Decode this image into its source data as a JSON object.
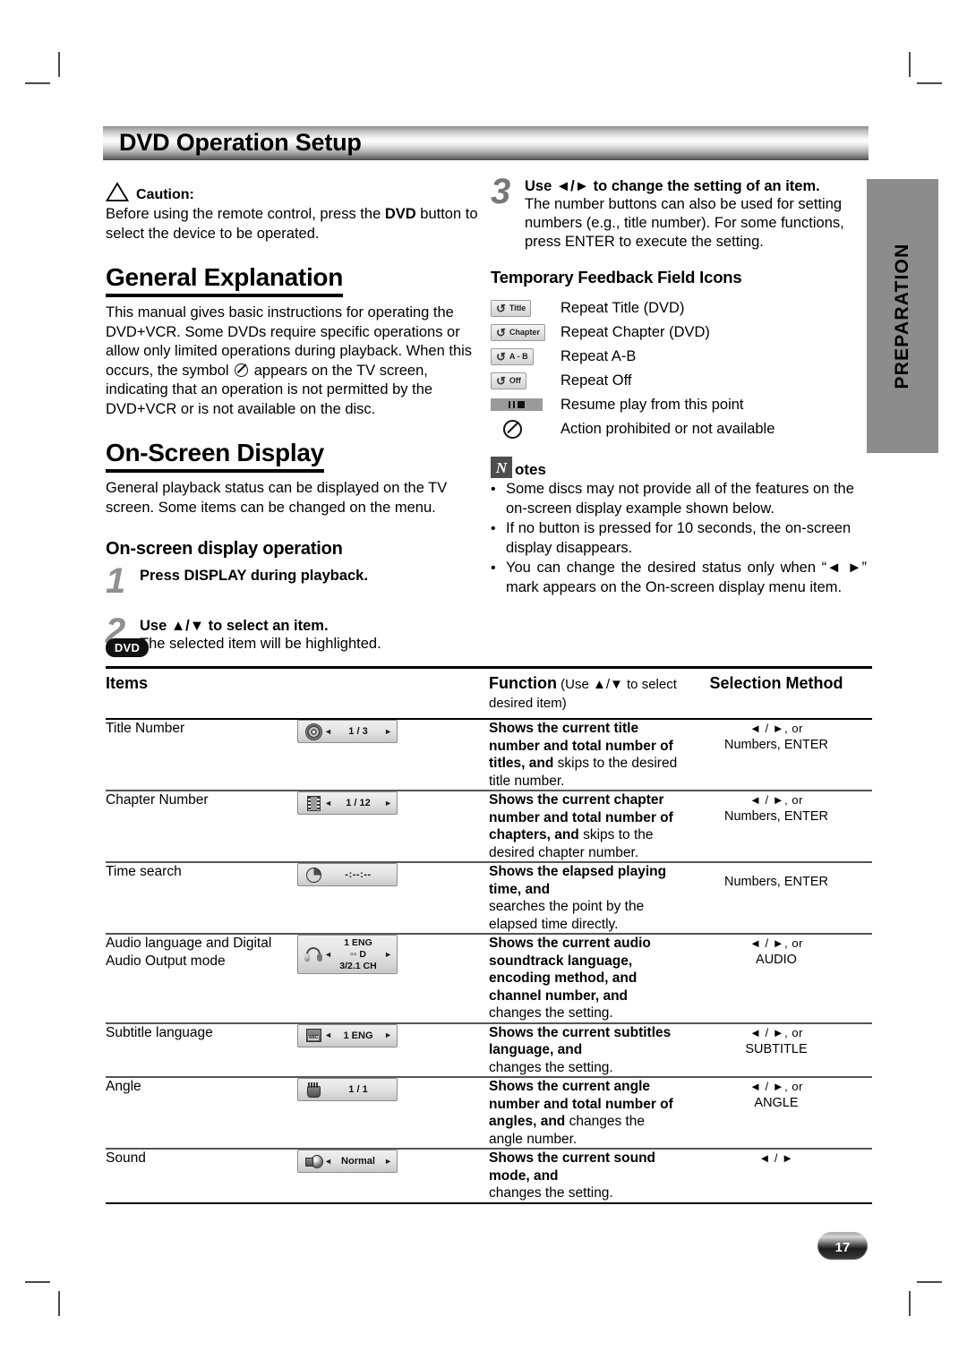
{
  "page": {
    "banner_title": "DVD Operation Setup",
    "side_tab": "PREPARATION",
    "page_number": "17",
    "disc_badge": "DVD"
  },
  "left": {
    "caution_label": "Caution:",
    "caution_text_a": "Before using the remote control, press the ",
    "caution_text_bold": "DVD",
    "caution_text_b": " button to select the device to be operated.",
    "general_heading": "General Explanation",
    "general_text_a": "This manual gives basic instructions for operating the DVD+VCR. Some DVDs require specific operations or allow only limited operations during playback. When this occurs, the symbol ",
    "general_text_b": " appears on the TV screen, indicating that an operation is not permitted by the DVD+VCR or is not available on the disc.",
    "osd_heading": "On-Screen Display",
    "osd_text": "General playback status can be displayed on the TV screen. Some items can be changed on the menu.",
    "osd_op_heading": "On-screen display operation",
    "steps": [
      {
        "num": "1",
        "title": "Press DISPLAY during playback.",
        "body": ""
      },
      {
        "num": "2",
        "title": "Use ▲/▼ to select an item.",
        "body": "The selected item will be highlighted."
      }
    ]
  },
  "right": {
    "step3": {
      "num": "3",
      "title": "Use ◄/► to change the setting of an item.",
      "body": "The number buttons can also be used for setting numbers (e.g., title number). For some functions, press ENTER to execute the setting."
    },
    "tff_heading": "Temporary Feedback Field Icons",
    "tff_items": [
      {
        "chip": "Title",
        "glyph": "↺",
        "label": "Repeat Title (DVD)",
        "kind": "chip"
      },
      {
        "chip": "Chapter",
        "glyph": "↺",
        "label": "Repeat Chapter (DVD)",
        "kind": "chip"
      },
      {
        "chip": "A - B",
        "glyph": "↺",
        "label": "Repeat A-B",
        "kind": "chip"
      },
      {
        "chip": "Off",
        "glyph": "↺",
        "label": "Repeat Off",
        "kind": "chip"
      },
      {
        "chip": "",
        "glyph": "",
        "label": "Resume play from this point",
        "kind": "resume"
      },
      {
        "chip": "",
        "glyph": "",
        "label": "Action prohibited or not available",
        "kind": "prohibit"
      }
    ],
    "notes_word": "otes",
    "notes_initial": "N",
    "notes": [
      "Some discs may not provide all of the features on the on-screen display example shown below.",
      "If no button is pressed for 10 seconds, the on-screen display disappears.",
      "You can change the desired status only when “◄ ►” mark appears on the On-screen display menu item."
    ]
  },
  "table": {
    "headers": {
      "items": "Items",
      "function_bold": "Function",
      "function_light": " (Use ▲/▼ to select desired item)",
      "selection": "Selection Method"
    },
    "rows": [
      {
        "item": "Title Number",
        "icon": "disc-icon",
        "osd": {
          "style": "single",
          "left_caret": "◄",
          "value": "1 / 3",
          "right_caret": "►"
        },
        "func_bold": "Shows the current title number and total number of titles, and",
        "func_rest": " skips to the desired title number.",
        "sel_line1": "◄ / ►, or",
        "sel_line2": "Numbers, ENTER"
      },
      {
        "item": "Chapter Number",
        "icon": "film-icon",
        "osd": {
          "style": "single",
          "left_caret": "◄",
          "value": "1 / 12",
          "right_caret": "►"
        },
        "func_bold": "Shows the current chapter number and total number of chapters, and",
        "func_rest": " skips to the desired chapter number.",
        "sel_line1": "◄ / ►, or",
        "sel_line2": "Numbers, ENTER"
      },
      {
        "item": "Time search",
        "icon": "clock-icon",
        "osd": {
          "style": "novalue",
          "left_caret": "",
          "value": "-:--:--",
          "right_caret": ""
        },
        "func_bold": "Shows the elapsed playing time, and",
        "func_rest": "searches the point by the elapsed time directly.",
        "sel_line1": "Numbers, ENTER",
        "sel_line2": ""
      },
      {
        "item": "Audio language and Digital Audio Output mode",
        "icon": "headphone-icon",
        "osd": {
          "style": "stack",
          "left_caret": "◄",
          "value": "1 ENG|▫▫ D|3/2.1 CH",
          "right_caret": "►"
        },
        "func_bold": "Shows the current audio soundtrack language, encoding method, and channel number, and",
        "func_rest": "changes the setting.",
        "sel_line1": "◄ / ►, or",
        "sel_line2": "AUDIO"
      },
      {
        "item": "Subtitle language",
        "icon": "subtitle-icon",
        "osd": {
          "style": "single",
          "left_caret": "◄",
          "value": "1 ENG",
          "right_caret": "►"
        },
        "func_bold": "Shows the current subtitles language, and",
        "func_rest": "changes the setting.",
        "sel_line1": "◄ / ►, or",
        "sel_line2": "SUBTITLE"
      },
      {
        "item": "Angle",
        "icon": "hand-icon",
        "osd": {
          "style": "novalue",
          "left_caret": "",
          "value": "1 / 1",
          "right_caret": ""
        },
        "func_bold": "Shows the current angle number and total number of angles, and",
        "func_rest": " changes the angle number.",
        "sel_line1": "◄ / ►, or",
        "sel_line2": "ANGLE"
      },
      {
        "item": "Sound",
        "icon": "speaker-icon",
        "osd": {
          "style": "single",
          "left_caret": "◄",
          "value": "Normal",
          "right_caret": "►"
        },
        "func_bold": "Shows the current sound mode, and",
        "func_rest": "changes the setting.",
        "sel_line1": "◄ / ►",
        "sel_line2": ""
      }
    ]
  }
}
